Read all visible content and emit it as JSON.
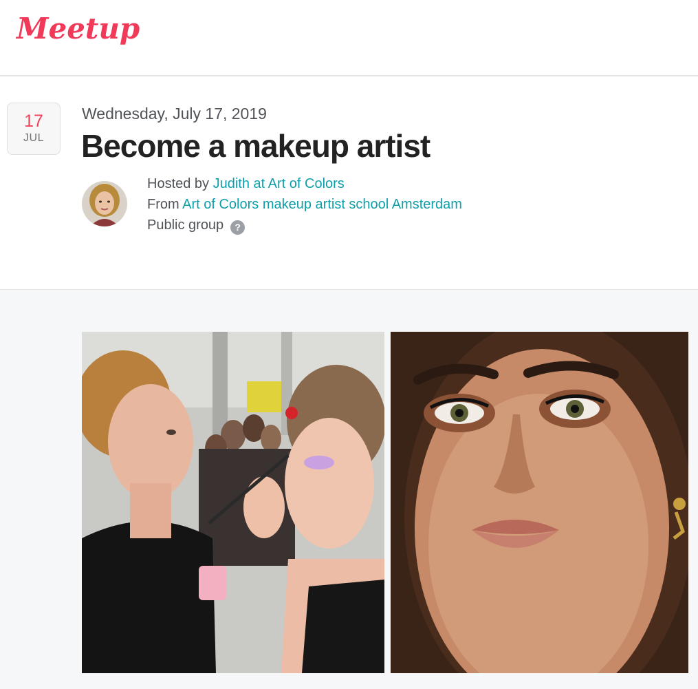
{
  "header": {
    "logo_text": "Meetup"
  },
  "event": {
    "date_badge": {
      "day": "17",
      "month": "JUL"
    },
    "date_line": "Wednesday, July 17, 2019",
    "title": "Become a makeup artist",
    "hosted_prefix": "Hosted by ",
    "host_name": "Judith at Art of Colors",
    "from_prefix": "From ",
    "group_name": "Art of Colors makeup artist school Amsterdam",
    "privacy": "Public group",
    "help_symbol": "?"
  },
  "photos": {
    "left": {
      "subject": "makeup artist applying eyeshadow at a crowded show"
    },
    "right": {
      "subject": "close-up portrait with smoky eye makeup"
    }
  },
  "colors": {
    "brand": "#f13a59",
    "link": "#0f9eaa",
    "date_red": "#f0405a",
    "section_bg": "#f6f7f8"
  },
  "icons": [
    "meetup-logo",
    "help-icon",
    "host-avatar"
  ]
}
